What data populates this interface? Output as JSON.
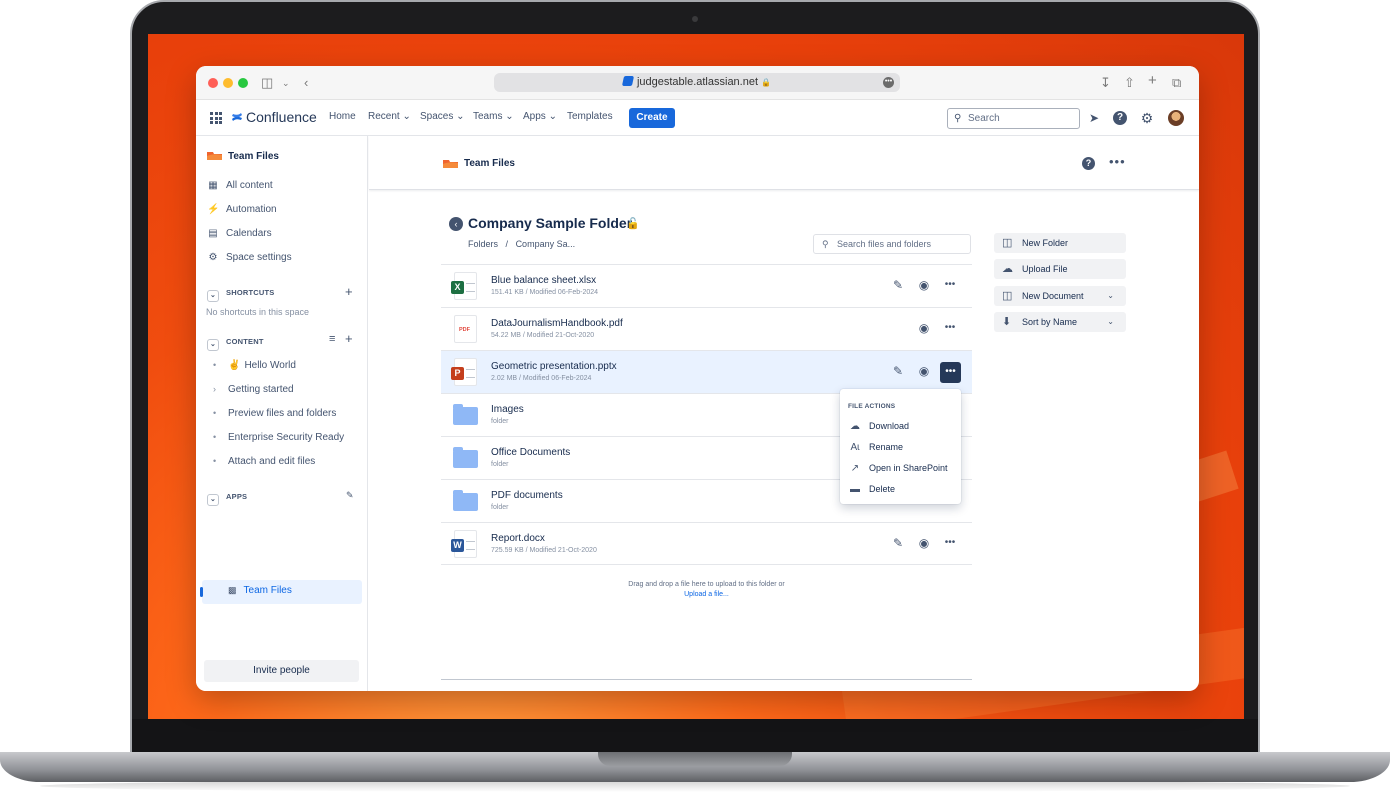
{
  "browser": {
    "url": "judgestable.atlassian.net"
  },
  "topnav": {
    "product": "Confluence",
    "items": [
      "Home",
      "Recent",
      "Spaces",
      "Teams",
      "Apps",
      "Templates"
    ],
    "create_label": "Create",
    "search_placeholder": "Search"
  },
  "sidebar": {
    "space_name": "Team Files",
    "items": [
      "All content",
      "Automation",
      "Calendars",
      "Space settings"
    ],
    "shortcuts_label": "SHORTCUTS",
    "shortcuts_empty": "No shortcuts in this space",
    "content_label": "CONTENT",
    "content_items": [
      "Hello World",
      "Getting started",
      "Preview files and folders",
      "Enterprise Security Ready",
      "Attach and edit files"
    ],
    "apps_label": "APPS",
    "apps_items": [
      "Team Files"
    ],
    "invite_label": "Invite people"
  },
  "header": {
    "title": "Team Files"
  },
  "folder": {
    "title": "Company Sample Folder",
    "breadcrumb_root": "Folders",
    "breadcrumb_sep": "/",
    "breadcrumb_current": "Company Sa...",
    "search_placeholder": "Search files and folders"
  },
  "files": [
    {
      "name": "Blue balance sheet.xlsx",
      "meta": "151.41 KB / Modified 06-Feb-2024",
      "kind": "xlsx"
    },
    {
      "name": "DataJournalismHandbook.pdf",
      "meta": "54.22 MB / Modified 21-Oct-2020",
      "kind": "pdf"
    },
    {
      "name": "Geometric presentation.pptx",
      "meta": "2.02 MB / Modified 06-Feb-2024",
      "kind": "pptx"
    },
    {
      "name": "Images",
      "meta": "folder",
      "kind": "folder"
    },
    {
      "name": "Office Documents",
      "meta": "folder",
      "kind": "folder"
    },
    {
      "name": "PDF documents",
      "meta": "folder",
      "kind": "folder"
    },
    {
      "name": "Report.docx",
      "meta": "725.59 KB / Modified 21-Oct-2020",
      "kind": "docx"
    }
  ],
  "file_badges": {
    "xlsx": "X",
    "pdf": "PDF",
    "pptx": "P",
    "docx": "W"
  },
  "colors": {
    "accent": "#1868db",
    "xlsx": "#1d6f42",
    "pptx": "#c43e1c",
    "docx": "#2b579a",
    "pdf": "#e2483d",
    "folder": "#8fb8f6",
    "selected_row": "#e9f2ff"
  },
  "menu": {
    "heading": "FILE ACTIONS",
    "items": [
      "Download",
      "Rename",
      "Open in SharePoint",
      "Delete"
    ]
  },
  "drop": {
    "text": "Drag and drop a file here to upload to this folder or",
    "link": "Upload a file..."
  },
  "actions": {
    "new_folder": "New Folder",
    "upload_file": "Upload File",
    "new_document": "New Document",
    "sort": "Sort by Name"
  }
}
